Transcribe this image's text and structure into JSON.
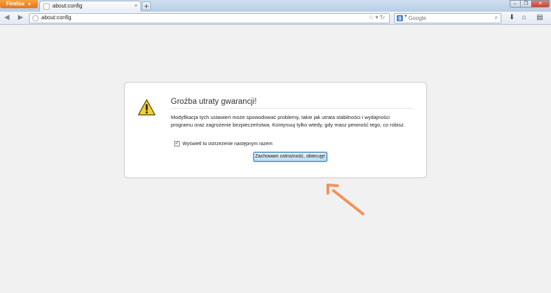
{
  "browser": {
    "menu_label": "Firefox",
    "tab_title": "about:config",
    "url": "about:config",
    "search_placeholder": "Google",
    "search_engine_icon": "google-g-icon"
  },
  "dialog": {
    "title": "Groźba utraty gwarancji!",
    "message": "Modyfikacja tych ustawień może spowodować problemy, takie jak utrata stabilności i wydajności programu oraz zagrożenie bezpieczeństwa. Kontynuuj tylko wtedy, gdy masz pewność tego, co robisz.",
    "checkbox_label": "Wyświetl to ostrzeżenie następnym razem",
    "checkbox_checked": true,
    "accept_label": "Zachowam ostrożność, obiecuję!"
  },
  "colors": {
    "firefox_orange": "#e4761e",
    "annotation_arrow": "#f4915a",
    "warning_yellow": "#f3d130"
  }
}
